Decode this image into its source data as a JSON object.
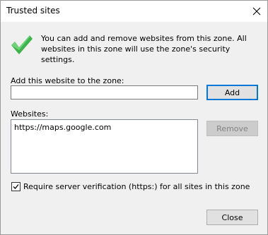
{
  "window": {
    "title": "Trusted sites"
  },
  "intro_text": "You can add and remove websites from this zone. All websites in this zone will use the zone's security settings.",
  "add_section": {
    "label": "Add this website to the zone:",
    "input_value": "",
    "add_button": "Add"
  },
  "websites_section": {
    "label": "Websites:",
    "items": [
      "https://maps.google.com"
    ],
    "remove_button": "Remove"
  },
  "verification": {
    "label": "Require server verification (https:) for all sites in this zone",
    "checked": true
  },
  "close_button": "Close",
  "colors": {
    "accent": "#0078d7",
    "check_green": "#3cb44a"
  }
}
